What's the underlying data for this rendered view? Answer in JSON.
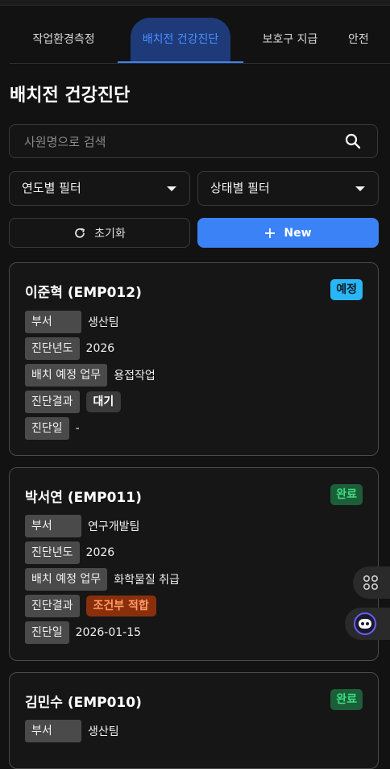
{
  "tabs": [
    {
      "label": "작업환경측정"
    },
    {
      "label": "배치전 건강진단"
    },
    {
      "label": "보호구 지급"
    },
    {
      "label": "안전"
    }
  ],
  "page_title": "배치전 건강진단",
  "search": {
    "placeholder": "사원명으로 검색",
    "value": ""
  },
  "filters": {
    "year": "연도별 필터",
    "status": "상태별 필터"
  },
  "buttons": {
    "reset": "초기화",
    "new": "New"
  },
  "records": [
    {
      "name": "이준혁 (EMP012)",
      "status": "예정",
      "status_color": "#29b6f6",
      "labels": {
        "dept": "부서",
        "year": "진단년도",
        "task": "배치 예정 업무",
        "result": "진단결과",
        "date": "진단일"
      },
      "dept": "생산팀",
      "year": "2026",
      "task": "용접작업",
      "result": "대기",
      "result_color": "#3a3a3a",
      "date": "-"
    },
    {
      "name": "박서연 (EMP011)",
      "status": "완료",
      "status_color": "#1b5e37",
      "labels": {
        "dept": "부서",
        "year": "진단년도",
        "task": "배치 예정 업무",
        "result": "진단결과",
        "date": "진단일"
      },
      "dept": "연구개발팀",
      "year": "2026",
      "task": "화학물질 취급",
      "result": "조건부 적합",
      "result_color": "#8a2f0c",
      "date": "2026-01-15"
    },
    {
      "name": "김민수 (EMP010)",
      "status": "완료",
      "status_color": "#1b5e37",
      "labels": {
        "dept": "부서"
      },
      "dept": "생산팀"
    }
  ]
}
